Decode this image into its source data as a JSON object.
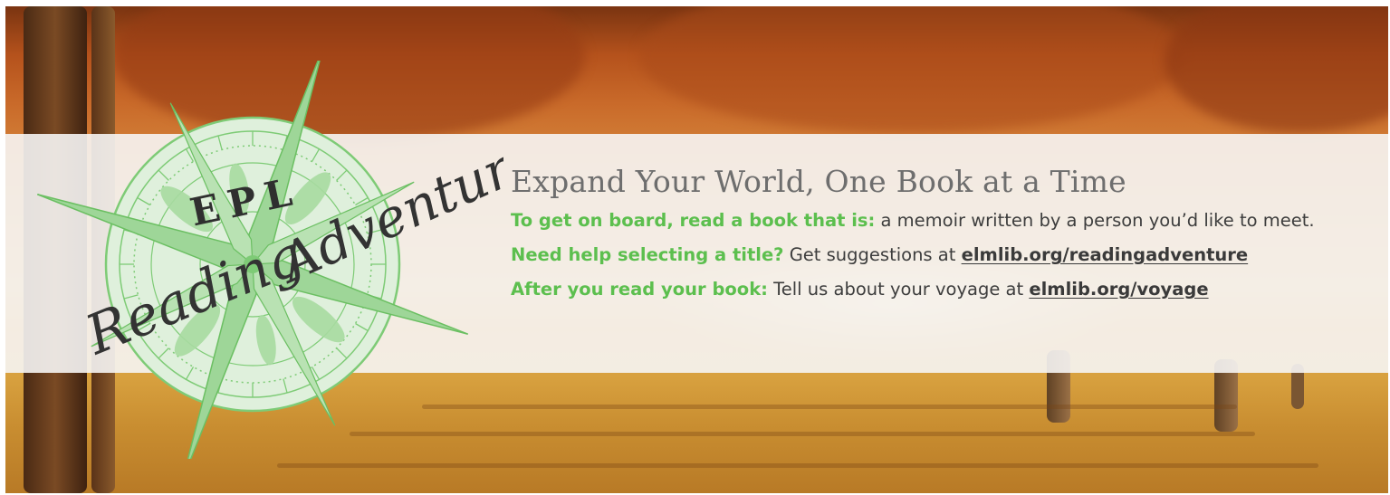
{
  "badge": {
    "top_word": "EPL",
    "script_words": [
      "Reading",
      "Adventure"
    ]
  },
  "headline": "Expand Your World, One Book at a Time",
  "lines": [
    {
      "lead": "To get on board, read a book that is:",
      "text": " a memoir written by a person you’d like to meet.",
      "link": ""
    },
    {
      "lead": "Need help selecting a title?",
      "text": " Get suggestions at ",
      "link": "elmlib.org/readingadventure"
    },
    {
      "lead": "After you read your book:",
      "text": " Tell us about your voyage at ",
      "link": "elmlib.org/voyage"
    }
  ],
  "colors": {
    "accent_green": "#5cbf4e",
    "badge_fill": "#dff0dc",
    "badge_stroke": "#7ecb76",
    "script_ink": "#333333"
  },
  "icons": [
    "compass-rose-icon"
  ]
}
